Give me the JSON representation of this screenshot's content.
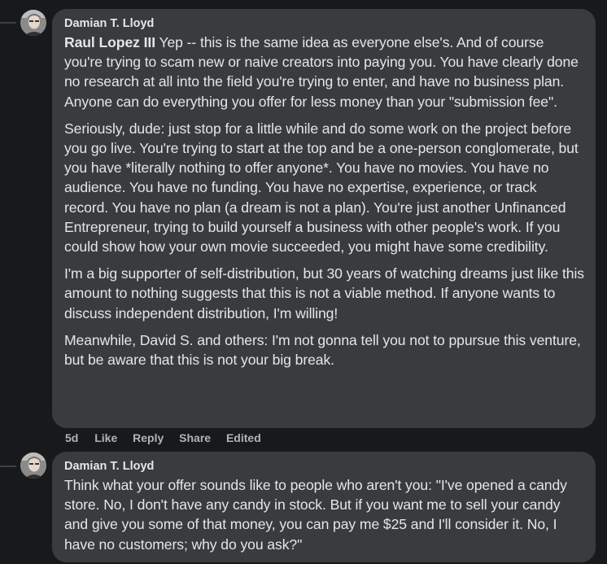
{
  "comments": [
    {
      "author": "Damian T. Lloyd",
      "mention": "Raul Lopez III",
      "first_paragraph_rest": " Yep -- this is the same idea as everyone else's. And of course you're trying to scam new or naive creators into paying you. You have clearly done no research at all into the field you're trying to enter, and have no business plan. Anyone can do everything you offer for less money than your \"submission fee\".",
      "paragraphs": [
        "Seriously, dude: just stop for a little while and do some work on the project before you go live. You're trying to start at the top and be a one-person conglomerate, but you have *literally nothing to offer anyone*. You have no movies. You have no audience. You have no funding. You have no expertise, experience, or track record. You have no plan (a dream is not a plan). You're just another Unfinanced Entrepreneur, trying to build yourself a business with other people's work. If you could show how your own movie succeeded, you might have some credibility.",
        "I'm a big supporter of self-distribution, but 30 years of watching dreams just like this amount to nothing suggests that this is not a viable method. If anyone wants to discuss independent distribution, I'm willing!",
        "Meanwhile, David S. and others: I'm not gonna tell you not to ppursue this venture, but be aware that this is not your big break."
      ],
      "time": "5d",
      "like_label": "Like",
      "reply_label": "Reply",
      "share_label": "Share",
      "edited_label": "Edited"
    },
    {
      "author": "Damian T. Lloyd",
      "paragraphs": [
        "Think what your offer sounds like to people who aren't you: \"I've opened a candy store. No, I don't have any candy in stock. But if you want me to sell your candy and give you some of that money, you can pay me $25 and I'll consider it. No, I have no customers; why do you ask?\""
      ]
    }
  ],
  "icons": {
    "avatar": "user-avatar-photo"
  }
}
